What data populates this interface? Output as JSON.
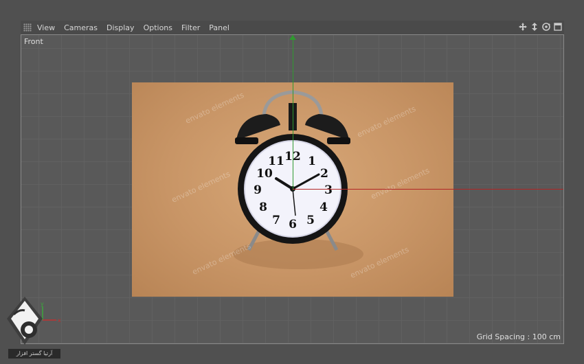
{
  "menu": {
    "items": [
      "View",
      "Cameras",
      "Display",
      "Options",
      "Filter",
      "Panel"
    ]
  },
  "nav_icons": [
    "move-view-icon",
    "dolly-view-icon",
    "rotate-view-icon",
    "maximize-view-icon"
  ],
  "viewport": {
    "label": "Front",
    "grid_spacing": "Grid Spacing : 100 cm"
  },
  "photo": {
    "clock_numbers": [
      "12",
      "1",
      "2",
      "3",
      "4",
      "5",
      "6",
      "7",
      "8",
      "9",
      "10",
      "11"
    ],
    "watermark_text": "envato elements"
  },
  "corner_axes": {
    "y": "y",
    "x": "x"
  },
  "colors": {
    "y_axis": "#2f9a2f",
    "x_axis": "#b22424",
    "paper": "#c89566"
  }
}
